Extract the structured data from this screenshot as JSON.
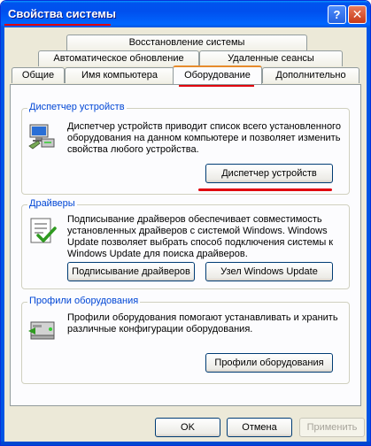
{
  "window": {
    "title": "Свойства системы",
    "help_label": "?",
    "close_label": "✕"
  },
  "tabs": {
    "row1": [
      {
        "label": "Восстановление системы"
      }
    ],
    "row2": [
      {
        "label": "Автоматическое обновление"
      },
      {
        "label": "Удаленные сеансы"
      }
    ],
    "row3": [
      {
        "label": "Общие"
      },
      {
        "label": "Имя компьютера"
      },
      {
        "label": "Оборудование",
        "active": true
      },
      {
        "label": "Дополнительно"
      }
    ]
  },
  "device_manager": {
    "label": "Диспетчер устройств",
    "text": "Диспетчер устройств приводит список всего установленного оборудования на данном компьютере и позволяет изменить свойства любого устройства.",
    "button": "Диспетчер устройств"
  },
  "drivers": {
    "label": "Драйверы",
    "text": "Подписывание драйверов обеспечивает совместимость установленных драйверов с системой Windows. Windows Update позволяет выбрать способ подключения системы к Windows Update для поиска драйверов.",
    "signing_button": "Подписывание драйверов",
    "update_button": "Узел Windows Update"
  },
  "profiles": {
    "label": "Профили оборудования",
    "text": "Профили оборудования помогают устанавливать и хранить различные конфигурации оборудования.",
    "button": "Профили оборудования"
  },
  "footer": {
    "ok": "OK",
    "cancel": "Отмена",
    "apply": "Применить"
  },
  "colors": {
    "titlebar": "#0054e3",
    "group_label": "#0046d5",
    "highlight_underline": "#e0000e",
    "active_tab_accent": "#e68b2c"
  }
}
